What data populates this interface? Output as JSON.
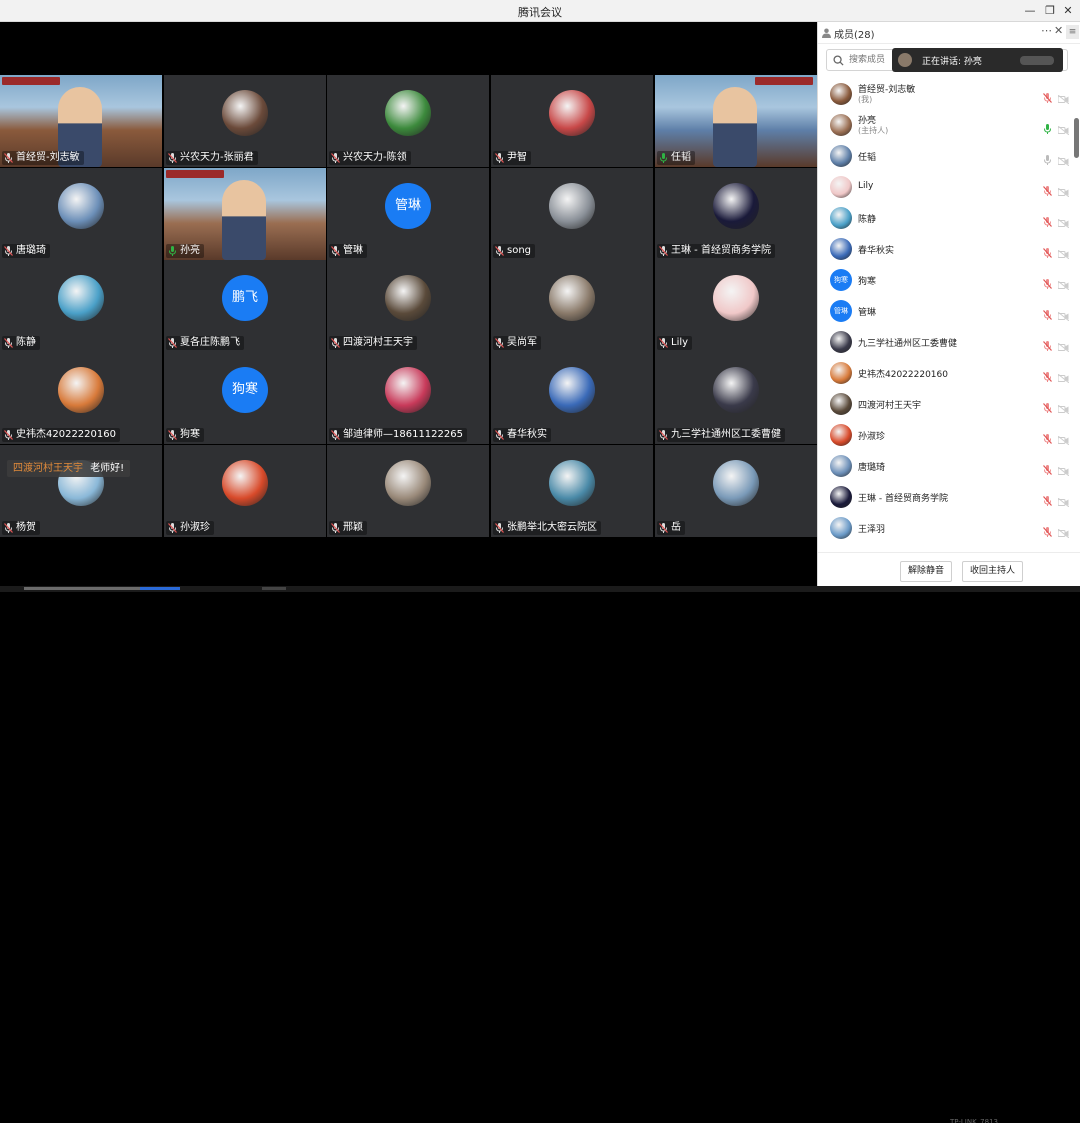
{
  "window": {
    "title": "腾讯会议"
  },
  "grid": {
    "tiles": [
      {
        "name": "首经贸-刘志敏",
        "kind": "video",
        "bg": "#8a5a3c"
      },
      {
        "name": "兴农天力-张丽君",
        "kind": "avatar",
        "bg": "#6b4a3a"
      },
      {
        "name": "兴农天力-陈领",
        "kind": "avatar",
        "bg": "#3c8a3c"
      },
      {
        "name": "尹智",
        "kind": "avatar",
        "bg": "#c84848"
      },
      {
        "name": "任韬",
        "kind": "video",
        "bg": "#5e7fa8"
      },
      {
        "name": "唐璐琦",
        "kind": "avatar",
        "bg": "#6c8fb8"
      },
      {
        "name": "孙亮",
        "kind": "video",
        "bg": "#9a6e52"
      },
      {
        "name": "管琳",
        "kind": "text",
        "text": "管琳"
      },
      {
        "name": "song",
        "kind": "avatar",
        "bg": "#8a9098"
      },
      {
        "name": "王琳 - 首经贸商务学院",
        "kind": "avatar",
        "bg": "#1a1a3a"
      },
      {
        "name": "陈静",
        "kind": "avatar",
        "bg": "#4aa0c8"
      },
      {
        "name": "夏各庄陈鹏飞",
        "kind": "text",
        "text": "鹏飞"
      },
      {
        "name": "四渡河村王天宇",
        "kind": "avatar",
        "bg": "#5a4a3a"
      },
      {
        "name": "吴尚军",
        "kind": "avatar",
        "bg": "#8a7a6a"
      },
      {
        "name": "Lily",
        "kind": "avatar",
        "bg": "#f0c8c8"
      },
      {
        "name": "史祎杰42022220160",
        "kind": "avatar",
        "bg": "#d87a3a"
      },
      {
        "name": "狗寒",
        "kind": "text",
        "text": "狗寒"
      },
      {
        "name": "邹迪律师—18611122265",
        "kind": "avatar",
        "bg": "#c83a5a"
      },
      {
        "name": "春华秋实",
        "kind": "avatar",
        "bg": "#3a6ab8"
      },
      {
        "name": "九三学社通州区工委曹健",
        "kind": "avatar",
        "bg": "#3a3a4a"
      },
      {
        "name": "杨贺",
        "kind": "avatar",
        "bg": "#8ab8d8"
      },
      {
        "name": "孙淑珍",
        "kind": "avatar",
        "bg": "#d84a2a"
      },
      {
        "name": "邢颖",
        "kind": "avatar",
        "bg": "#9a8a7a"
      },
      {
        "name": "张鹏举北大密云院区",
        "kind": "avatar",
        "bg": "#4a8aa8"
      },
      {
        "name": "岳",
        "kind": "avatar",
        "bg": "#7a9ab8"
      }
    ],
    "chat_bubble": {
      "sender": "四渡河村王天宇",
      "message": "老师好!"
    }
  },
  "panel": {
    "title": "成员(28)",
    "search_placeholder": "搜索成员",
    "speaking_tip": "正在讲话: 孙亮",
    "members": [
      {
        "name": "首经贸-刘志敏",
        "sub": "(我)",
        "bg": "#8a5a3c",
        "mic": "muted"
      },
      {
        "name": "孙亮",
        "sub": "(主持人)",
        "bg": "#9a6e52",
        "mic": "active"
      },
      {
        "name": "任韬",
        "sub": "",
        "bg": "#5e7fa8",
        "mic": "on"
      },
      {
        "name": "Lily",
        "sub": "",
        "bg": "#f0c8c8",
        "mic": "muted"
      },
      {
        "name": "陈静",
        "sub": "",
        "bg": "#4aa0c8",
        "mic": "muted"
      },
      {
        "name": "春华秋实",
        "sub": "",
        "bg": "#3a6ab8",
        "mic": "muted"
      },
      {
        "name": "狗寒",
        "sub": "",
        "text": "狗寒",
        "mic": "muted"
      },
      {
        "name": "管琳",
        "sub": "",
        "text": "管琳",
        "mic": "muted"
      },
      {
        "name": "九三学社通州区工委曹健",
        "sub": "",
        "bg": "#3a3a4a",
        "mic": "muted"
      },
      {
        "name": "史祎杰42022220160",
        "sub": "",
        "bg": "#d87a3a",
        "mic": "muted"
      },
      {
        "name": "四渡河村王天宇",
        "sub": "",
        "bg": "#5a4a3a",
        "mic": "muted"
      },
      {
        "name": "孙淑珍",
        "sub": "",
        "bg": "#d84a2a",
        "mic": "muted"
      },
      {
        "name": "唐璐琦",
        "sub": "",
        "bg": "#6c8fb8",
        "mic": "muted"
      },
      {
        "name": "王琳 - 首经贸商务学院",
        "sub": "",
        "bg": "#1a1a3a",
        "mic": "muted"
      },
      {
        "name": "王泽羽",
        "sub": "",
        "bg": "#6a9ac8",
        "mic": "muted"
      }
    ],
    "buttons": {
      "unmute_all": "解除静音",
      "reclaim_host": "收回主持人"
    },
    "network_label": "TP-LINK_7813"
  },
  "colors": {
    "accent": "#1a7cf4",
    "muted": "#e05555",
    "active": "#2fb344"
  }
}
